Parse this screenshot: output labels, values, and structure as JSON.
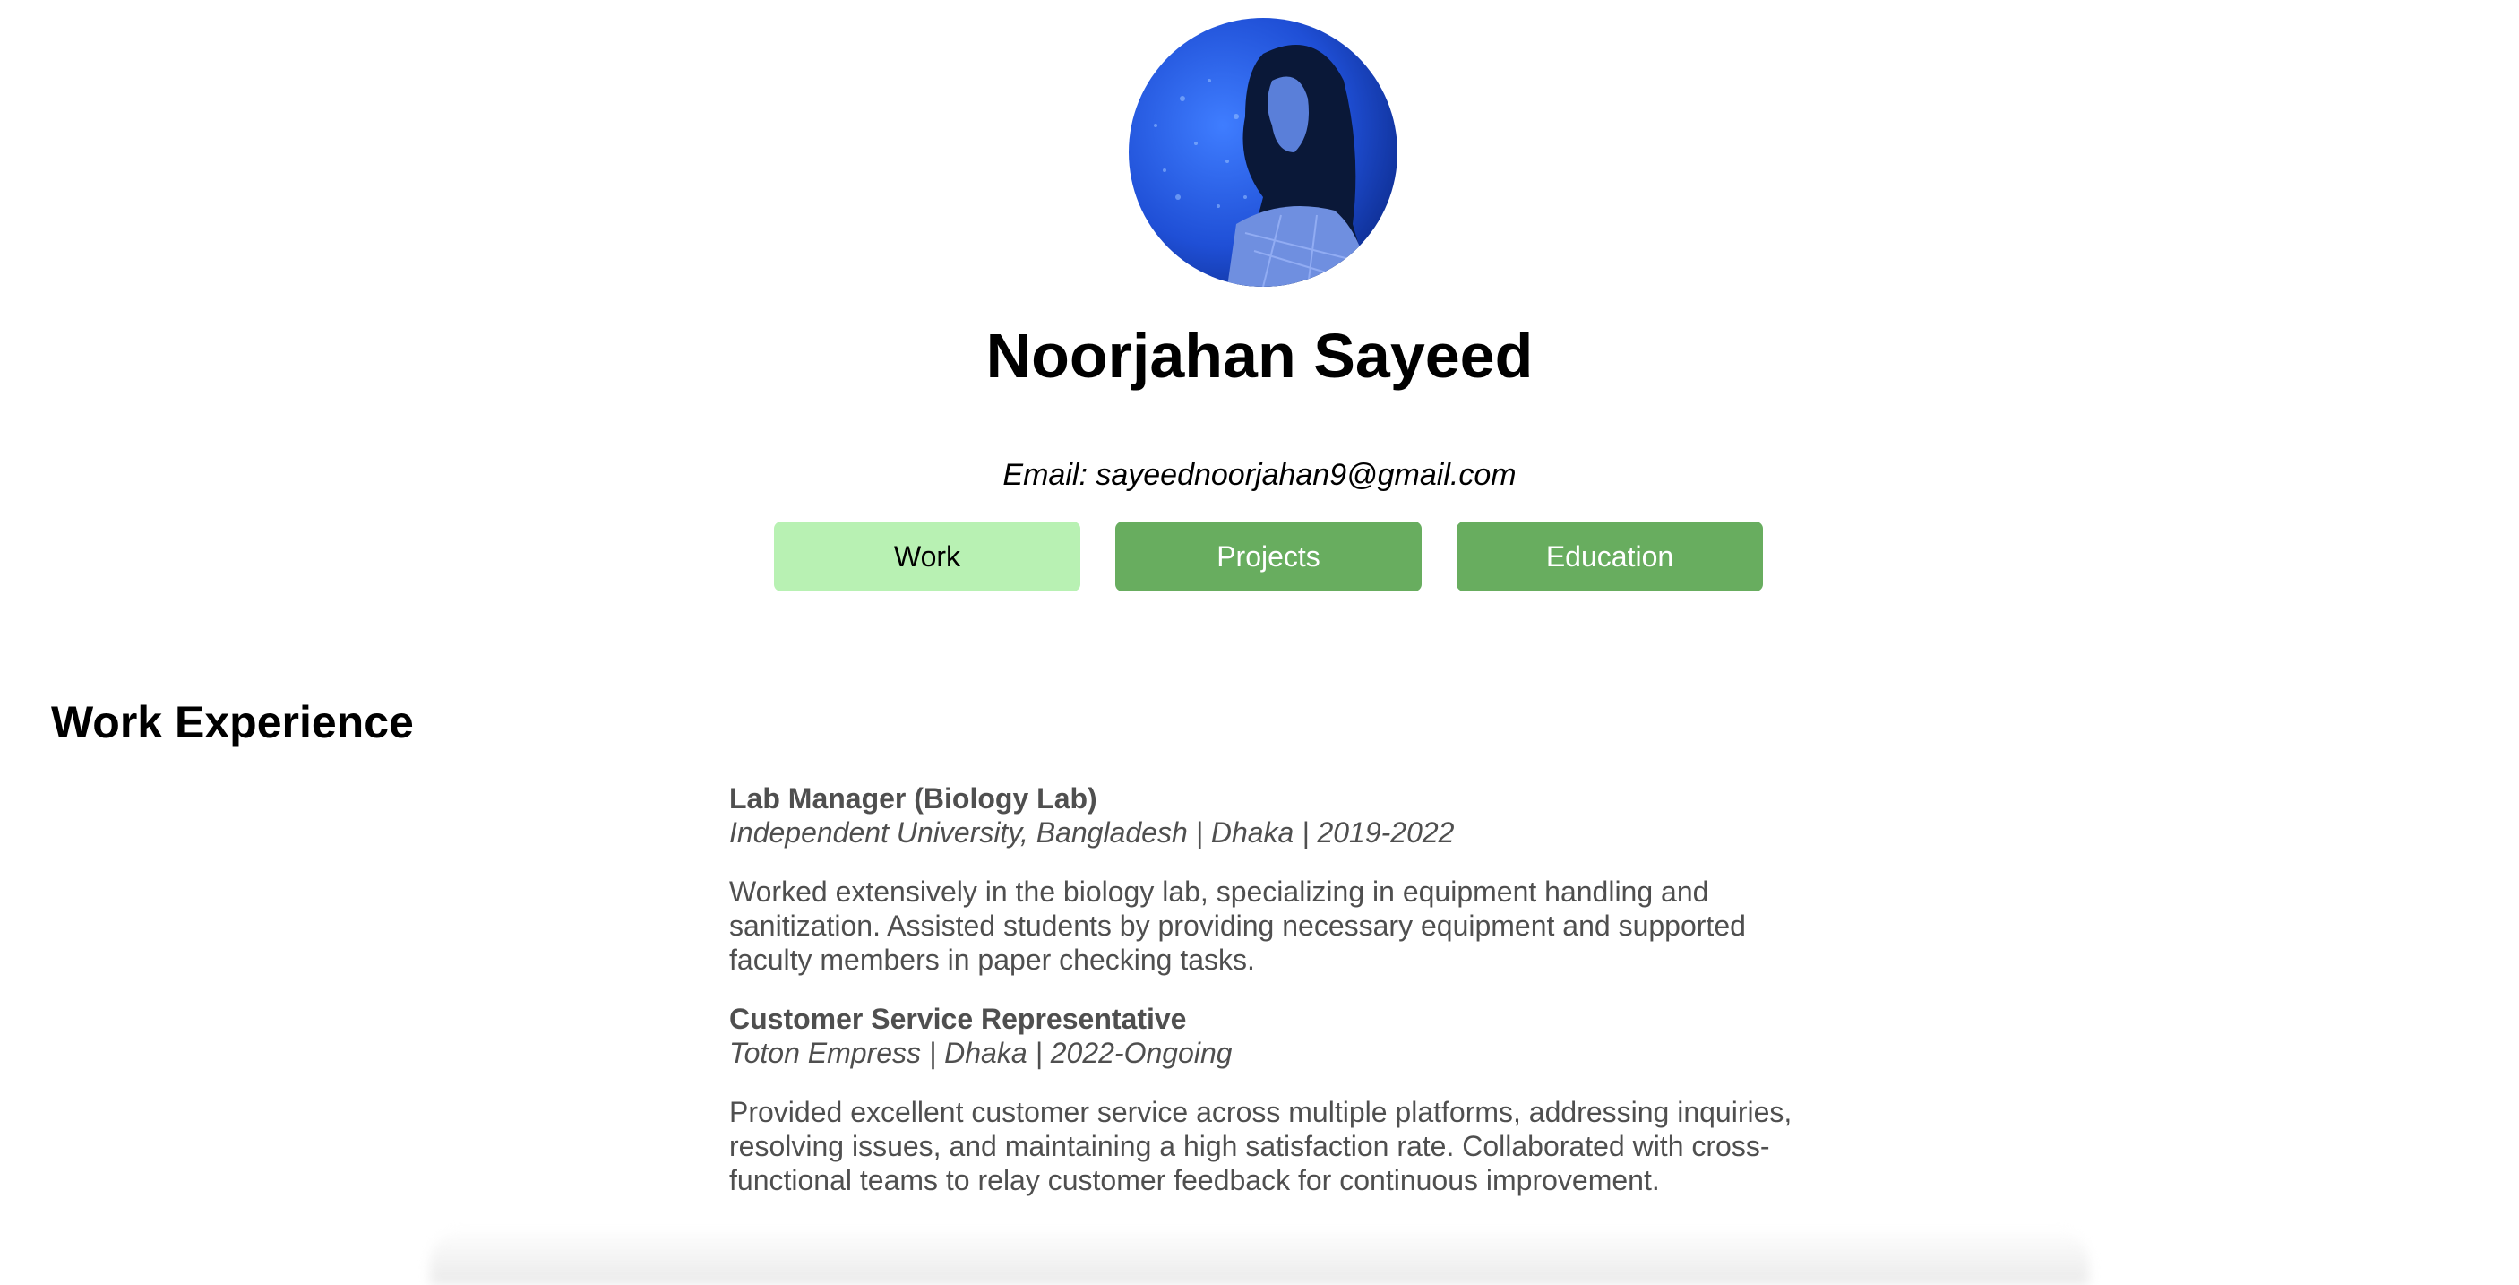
{
  "profile": {
    "name": "Noorjahan Sayeed",
    "email_label": "Email:",
    "email": "sayeednoorjahan9@gmail.com"
  },
  "tabs": [
    {
      "label": "Work",
      "active": true
    },
    {
      "label": "Projects",
      "active": false
    },
    {
      "label": "Education",
      "active": false
    }
  ],
  "colors": {
    "active_tab": "#b8f1b3",
    "inactive_tab": "#68ad5f",
    "body_text": "#4f4f4f"
  },
  "work": {
    "heading": "Work Experience",
    "jobs": [
      {
        "title": "Lab Manager (Biology Lab)",
        "meta": "Independent University, Bangladesh | Dhaka | 2019-2022",
        "description": "Worked extensively in the biology lab, specializing in equipment handling and sanitization. Assisted students by providing necessary equipment and supported faculty members in paper checking tasks."
      },
      {
        "title": "Customer Service Representative",
        "meta": "Toton Empress | Dhaka | 2022-Ongoing",
        "description": "Provided excellent customer service across multiple platforms, addressing inquiries, resolving issues, and maintaining a high satisfaction rate. Collaborated with cross-functional teams to relay customer feedback for continuous improvement."
      }
    ]
  }
}
